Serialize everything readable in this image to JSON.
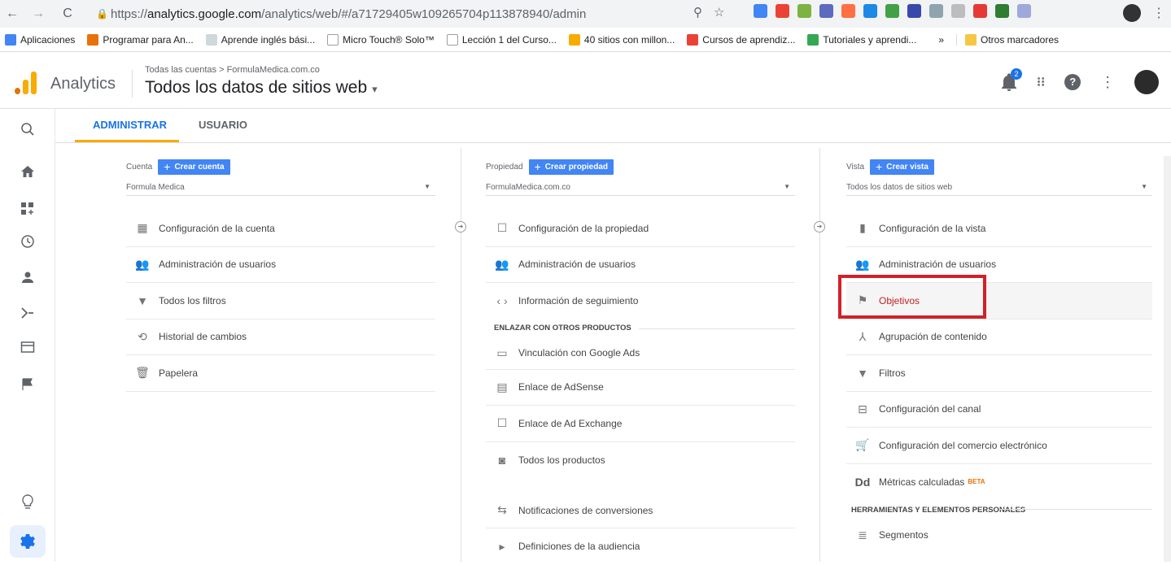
{
  "browser": {
    "url_host": "analytics.google.com",
    "url_scheme": "https://",
    "url_path": "/analytics/web/#/a71729405w109265704p113878940/admin",
    "bookmarks": [
      {
        "label": "Aplicaciones",
        "color": "#4285f4"
      },
      {
        "label": "Programar para An...",
        "color": "#e8710a"
      },
      {
        "label": "Aprende inglés bási...",
        "color": "#9e9e9e"
      },
      {
        "label": "Micro Touch® Solo™",
        "color": "#9e9e9e"
      },
      {
        "label": "Lección 1 del Curso...",
        "color": "#9e9e9e"
      },
      {
        "label": "40 sitios con millon...",
        "color": "#f9ab00"
      },
      {
        "label": "Cursos de aprendiz...",
        "color": "#ea4335"
      },
      {
        "label": "Tutoriales y aprendi...",
        "color": "#34a853"
      }
    ],
    "bookmarks_more": "»",
    "other_bookmarks": "Otros marcadores"
  },
  "header": {
    "app_name": "Analytics",
    "breadcrumb": "Todas las cuentas > FormulaMedica.com.co",
    "view_title": "Todos los datos de sitios web",
    "notification_count": "2"
  },
  "tabs": [
    {
      "label": "ADMINISTRAR",
      "active": true
    },
    {
      "label": "USUARIO",
      "active": false
    }
  ],
  "columns": {
    "account": {
      "heading": "Cuenta",
      "create_label": "Crear cuenta",
      "selected": "Formula Medica",
      "items": [
        {
          "label": "Configuración de la cuenta",
          "icon": "building-icon"
        },
        {
          "label": "Administración de usuarios",
          "icon": "users-icon"
        },
        {
          "label": "Todos los filtros",
          "icon": "filter-icon"
        },
        {
          "label": "Historial de cambios",
          "icon": "history-icon"
        },
        {
          "label": "Papelera",
          "icon": "trash-icon"
        }
      ]
    },
    "property": {
      "heading": "Propiedad",
      "create_label": "Crear propiedad",
      "selected": "FormulaMedica.com.co",
      "items": [
        {
          "label": "Configuración de la propiedad",
          "icon": "window-icon"
        },
        {
          "label": "Administración de usuarios",
          "icon": "users-icon"
        },
        {
          "label": "Información de seguimiento",
          "icon": "code-icon"
        }
      ],
      "section_label": "ENLAZAR CON OTROS PRODUCTOS",
      "linked_items": [
        {
          "label": "Vinculación con Google Ads",
          "icon": "ads-icon"
        },
        {
          "label": "Enlace de AdSense",
          "icon": "adsense-icon"
        },
        {
          "label": "Enlace de Ad Exchange",
          "icon": "adexchange-icon"
        },
        {
          "label": "Todos los productos",
          "icon": "products-icon"
        },
        {
          "label": "Notificaciones de conversiones",
          "icon": "postback-icon"
        },
        {
          "label": "Definiciones de la audiencia",
          "icon": "audience-icon"
        }
      ]
    },
    "view": {
      "heading": "Vista",
      "create_label": "Crear vista",
      "selected": "Todos los datos de sitios web",
      "items": [
        {
          "label": "Configuración de la vista",
          "icon": "document-icon"
        },
        {
          "label": "Administración de usuarios",
          "icon": "users-icon"
        },
        {
          "label": "Objetivos",
          "icon": "flag-icon"
        },
        {
          "label": "Agrupación de contenido",
          "icon": "grouping-icon"
        },
        {
          "label": "Filtros",
          "icon": "filter-icon"
        },
        {
          "label": "Configuración del canal",
          "icon": "channel-icon"
        },
        {
          "label": "Configuración del comercio electrónico",
          "icon": "cart-icon"
        },
        {
          "label": "Métricas calculadas",
          "icon": "dd-icon",
          "badge": "BETA"
        }
      ],
      "section_label": "HERRAMIENTAS Y ELEMENTOS PERSONALES",
      "tool_items": [
        {
          "label": "Segmentos",
          "icon": "segments-icon"
        }
      ]
    }
  },
  "colors": {
    "accent": "#1a73e8",
    "button": "#4285f4",
    "tab_underline": "#f9ab00",
    "highlight": "#d32027"
  }
}
